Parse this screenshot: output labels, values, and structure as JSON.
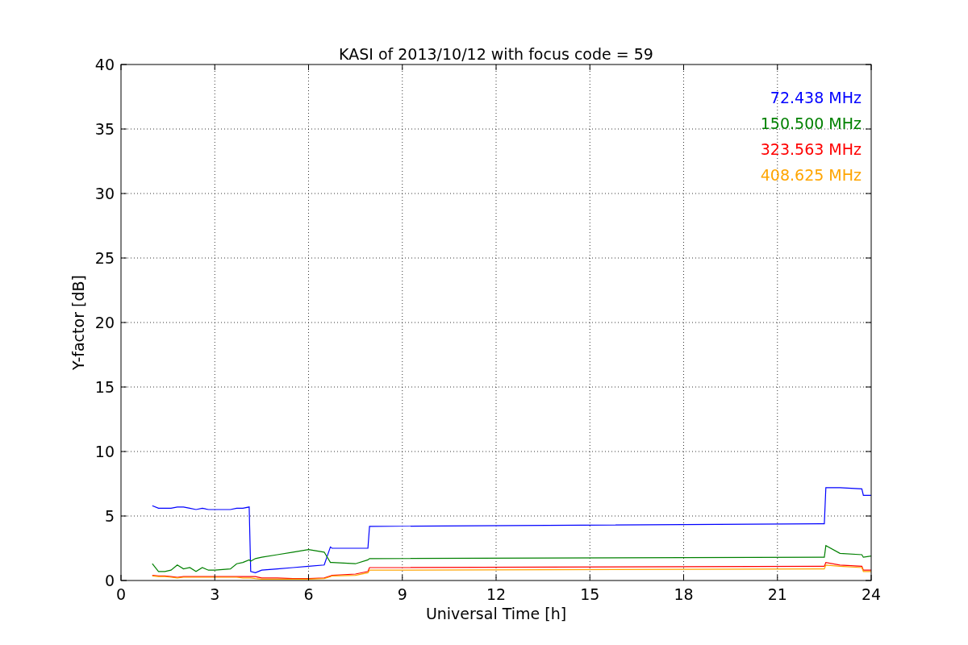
{
  "figure": {
    "chart_data": {
      "type": "line",
      "title": "KASI of 2013/10/12 with focus code = 59",
      "xlabel": "Universal Time [h]",
      "ylabel": "Y-factor [dB]",
      "x": [
        1.0,
        1.2,
        1.4,
        1.6,
        1.8,
        2.0,
        2.2,
        2.4,
        2.6,
        2.8,
        3.0,
        3.5,
        3.7,
        3.9,
        4.1,
        4.15,
        4.3,
        4.5,
        5,
        5.5,
        6,
        6.5,
        6.7,
        6.75,
        7.5,
        7.9,
        7.95,
        8.0,
        22.5,
        22.55,
        23,
        23.7,
        23.75,
        24
      ],
      "series": [
        {
          "name": "72.438 MHz",
          "color": "#0000ff",
          "values": [
            5.8,
            5.6,
            5.6,
            5.6,
            5.7,
            5.7,
            5.6,
            5.5,
            5.6,
            5.5,
            5.5,
            5.5,
            5.6,
            5.6,
            5.7,
            0.7,
            0.6,
            0.8,
            0.9,
            1.0,
            1.1,
            1.2,
            2.6,
            2.5,
            2.5,
            2.5,
            4.2,
            4.2,
            4.4,
            7.2,
            7.2,
            7.1,
            6.6,
            6.6
          ]
        },
        {
          "name": "150.500 MHz",
          "color": "#008000",
          "values": [
            1.3,
            0.7,
            0.7,
            0.8,
            1.2,
            0.9,
            1.0,
            0.7,
            1.0,
            0.8,
            0.8,
            0.9,
            1.3,
            1.4,
            1.6,
            1.5,
            1.7,
            1.8,
            2.0,
            2.2,
            2.4,
            2.2,
            1.4,
            1.4,
            1.3,
            1.6,
            1.7,
            1.7,
            1.8,
            2.7,
            2.1,
            2.0,
            1.8,
            1.9
          ]
        },
        {
          "name": "323.563 MHz",
          "color": "#ff0000",
          "values": [
            0.4,
            0.35,
            0.35,
            0.3,
            0.25,
            0.3,
            0.3,
            0.3,
            0.3,
            0.3,
            0.3,
            0.3,
            0.3,
            0.3,
            0.3,
            0.3,
            0.3,
            0.2,
            0.2,
            0.15,
            0.15,
            0.2,
            0.35,
            0.4,
            0.5,
            0.7,
            1.0,
            1.0,
            1.1,
            1.4,
            1.2,
            1.1,
            0.8,
            0.8
          ]
        },
        {
          "name": "408.625 MHz",
          "color": "#ffa500",
          "values": [
            0.35,
            0.3,
            0.3,
            0.25,
            0.2,
            0.25,
            0.25,
            0.25,
            0.25,
            0.25,
            0.25,
            0.25,
            0.25,
            0.2,
            0.2,
            0.2,
            0.15,
            0.1,
            0.1,
            0.1,
            0.1,
            0.15,
            0.3,
            0.35,
            0.4,
            0.6,
            0.8,
            0.8,
            0.9,
            1.2,
            1.1,
            1.0,
            0.7,
            0.7
          ]
        }
      ],
      "grid": true,
      "xlim": [
        0,
        24
      ],
      "ylim": [
        0,
        40
      ],
      "xticks": [
        0,
        3,
        6,
        9,
        12,
        15,
        18,
        21,
        24
      ],
      "yticks": [
        0,
        5,
        10,
        15,
        20,
        25,
        30,
        35,
        40
      ]
    }
  }
}
